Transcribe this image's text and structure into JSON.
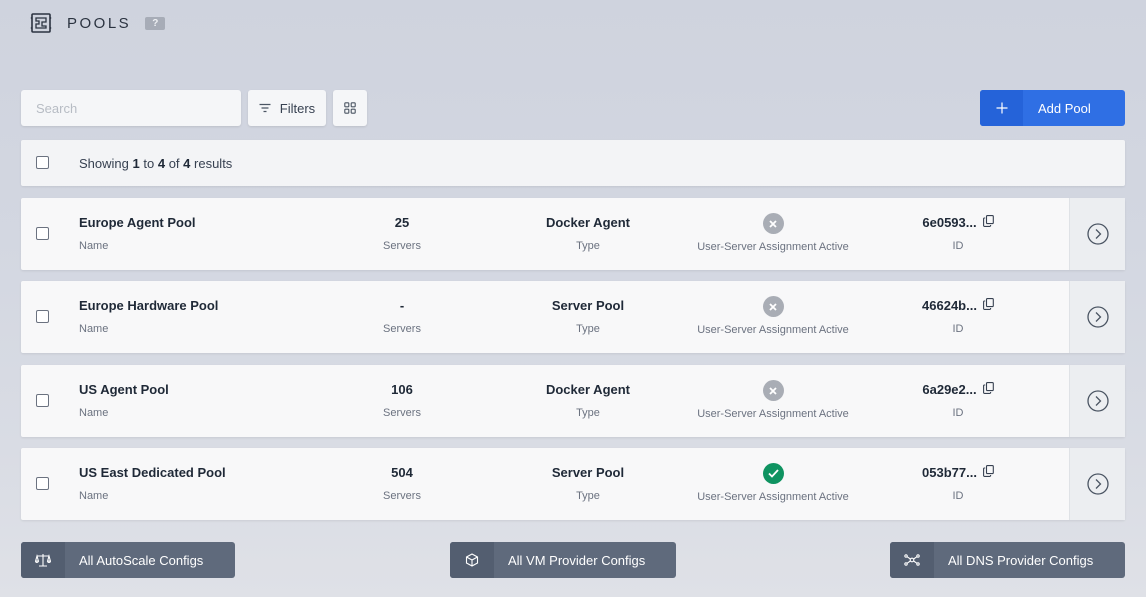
{
  "header": {
    "title": "POOLS",
    "help_label": "?",
    "icon": "pool-icon"
  },
  "toolbar": {
    "search_placeholder": "Search",
    "search_value": "",
    "filters_label": "Filters",
    "filters_icon": "filter-icon",
    "grid_icon": "grid-view-icon",
    "add_label": "Add Pool",
    "add_icon": "plus-icon"
  },
  "summary": {
    "prefix": "Showing",
    "from": "1",
    "to_word": "to",
    "to": "4",
    "of_word": "of",
    "total": "4",
    "suffix": "results"
  },
  "columns": {
    "name": "Name",
    "servers": "Servers",
    "type": "Type",
    "assignment": "User-Server Assignment Active",
    "id": "ID"
  },
  "rows": [
    {
      "name": "Europe Agent Pool",
      "servers": "25",
      "type": "Docker Agent",
      "assignment_active": false,
      "id": "6e0593..."
    },
    {
      "name": "Europe Hardware Pool",
      "servers": "-",
      "type": "Server Pool",
      "assignment_active": false,
      "id": "46624b..."
    },
    {
      "name": "US Agent Pool",
      "servers": "106",
      "type": "Docker Agent",
      "assignment_active": false,
      "id": "6a29e2..."
    },
    {
      "name": "US East Dedicated Pool",
      "servers": "504",
      "type": "Server Pool",
      "assignment_active": true,
      "id": "053b77..."
    }
  ],
  "footer": {
    "autoscale_label": "All AutoScale Configs",
    "autoscale_icon": "scale-icon",
    "vm_label": "All VM Provider Configs",
    "vm_icon": "cube-icon",
    "dns_label": "All DNS Provider Configs",
    "dns_icon": "network-icon"
  },
  "colors": {
    "primary": "#2f6fe4",
    "footer_button": "#5f6a7c",
    "status_active": "#0f9361",
    "status_inactive": "#a9adb5"
  }
}
